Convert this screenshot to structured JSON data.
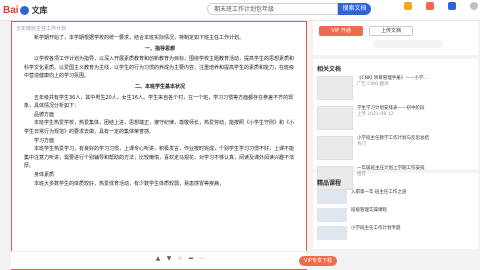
{
  "header": {
    "logo_text_1": "Bai",
    "logo_text_2": "文库",
    "search_value": "期末班工作计划包年级",
    "search_button": "搜索文档",
    "nav": [
      "",
      "",
      "",
      ""
    ]
  },
  "document": {
    "title": "五年级班主任工作计划",
    "paragraphs": [
      {
        "t": "ind",
        "text": "新学期开始了，本学期根据学校的统一要求，结合本班实际情况，特制定如下班主任工作计划。"
      },
      {
        "t": "h",
        "text": "一、指导思想"
      },
      {
        "t": "ind",
        "text": "以学校各项工作计划为指导，以深入开展素质教育和创新教育为目标，围绕学校主题教育活动，提高学生的思想素质和科学文化素质。以爱国主义教育为主线，以学生的行为习惯的养成为主要内容，注重培养和提高学生的素质和能力，在班级中营造健康向上的学习氛围。"
      },
      {
        "t": "h",
        "text": "二、本班学生基本状况"
      },
      {
        "t": "ind",
        "text": "五年级共有学生36人，其中男生20人，女生16人。学生来自各个村，在一个班，学习习惯等方面都存在参差不齐的现象，具体情况分析如下："
      },
      {
        "t": "sub",
        "text": "品德方面"
      },
      {
        "t": "ind",
        "text": "本班学生热爱学校，热爱集体，团结上进，思想端正，遵守纪律，尊敬师长，热爱劳动，能按照《小学生守则》和《小学生日常行为规范》的要求去做，具有一定的集体荣誉感。"
      },
      {
        "t": "sub",
        "text": "学习方面"
      },
      {
        "t": "ind",
        "text": "本班学生热爱学习，有良好的学习习惯，上课专心听讲，积极发言，作业按时完成，个别学生学习习惯不好，上课不能集中注意力听讲，需要进行个别辅导和帮助的方法，比较懒惰，喜欢走马观花，对学习不够认真，阅读及课外阅读兴趣不浓厚。"
      },
      {
        "t": "sub",
        "text": "身体素质"
      },
      {
        "t": "ind",
        "text": "本班大多数学生的体质较好，热爱体育活动，有少数学生体质较弱，易患感冒等疾病，"
      }
    ]
  },
  "bottombar": {
    "download_button": "VIP专享下载"
  },
  "sidebar": {
    "btn1": "VIP 开通",
    "btn2": "上传文档",
    "pill_text": "",
    "related_title": "相关文档",
    "related": [
      {
        "title": "《CNKI 项目管理手册》——小学…",
        "meta": "广告 CNKI 翻译"
      },
      {
        "title": "学生学习计划安排表——初中阶段",
        "meta": "上传 2021-08-12"
      },
      {
        "title": "小学班主任教学工作计划与反思总结",
        "meta": "热门"
      },
      {
        "title": "一年级班主任计划上学期工作安排",
        "meta": "推荐"
      }
    ],
    "course_title": "精品课程",
    "courses": [
      {
        "title": "入职第一年·班主任工作之道",
        "meta": ""
      },
      {
        "title": "班级管理实操课程",
        "meta": ""
      },
      {
        "title": "小学班主任工作计划专题",
        "meta": ""
      }
    ]
  },
  "colors": {
    "accent": "#2f64d8",
    "cta": "#f2694f",
    "frame": "#e45c4c"
  }
}
